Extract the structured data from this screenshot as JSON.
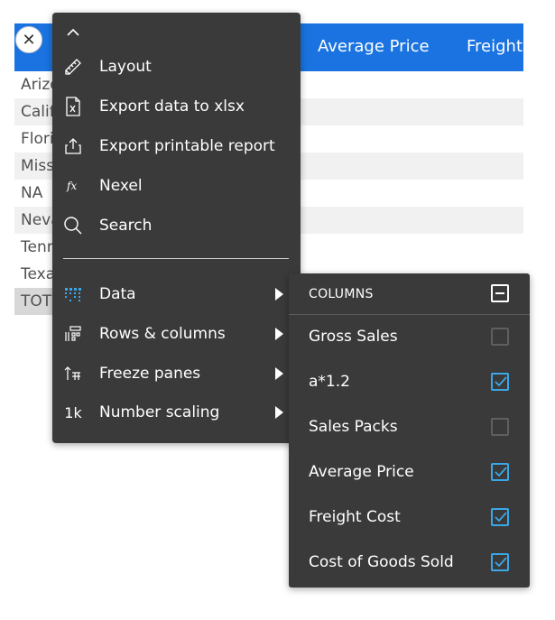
{
  "table": {
    "headers": [
      "Average Price",
      "Freight"
    ],
    "rows": [
      {
        "label": "Arizo"
      },
      {
        "label": "Calif"
      },
      {
        "label": "Flori"
      },
      {
        "label": "Miss"
      },
      {
        "label": "NA"
      },
      {
        "label": "Neva"
      },
      {
        "label": "Tenn"
      },
      {
        "label": "Texa"
      },
      {
        "label": "TOT"
      }
    ],
    "close_glyph": "✕"
  },
  "menu": {
    "items": [
      {
        "label": "Layout",
        "icon": "layout-icon"
      },
      {
        "label": "Export data to xlsx",
        "icon": "xlsx-file-icon"
      },
      {
        "label": "Export printable report",
        "icon": "share-export-icon"
      },
      {
        "label": "Nexel",
        "icon": "fx-icon"
      },
      {
        "label": "Search",
        "icon": "search-icon"
      }
    ],
    "submenus": [
      {
        "label": "Data",
        "icon": "data-grid-icon"
      },
      {
        "label": "Rows & columns",
        "icon": "rows-columns-icon"
      },
      {
        "label": "Freeze panes",
        "icon": "freeze-panes-icon"
      },
      {
        "label": "Number scaling",
        "icon": "number-scaling-icon",
        "icon_text": "1k"
      }
    ]
  },
  "columns_panel": {
    "title": "COLUMNS",
    "items": [
      {
        "label": "Gross Sales",
        "checked": false
      },
      {
        "label": "a*1.2",
        "checked": true
      },
      {
        "label": "Sales Packs",
        "checked": false
      },
      {
        "label": "Average Price",
        "checked": true
      },
      {
        "label": "Freight Cost",
        "checked": true
      },
      {
        "label": "Cost of Goods Sold",
        "checked": true
      }
    ]
  },
  "colors": {
    "header_blue": "#1a73e0",
    "menu_bg": "#3a3a3a",
    "check_accent": "#3aa8e8"
  }
}
